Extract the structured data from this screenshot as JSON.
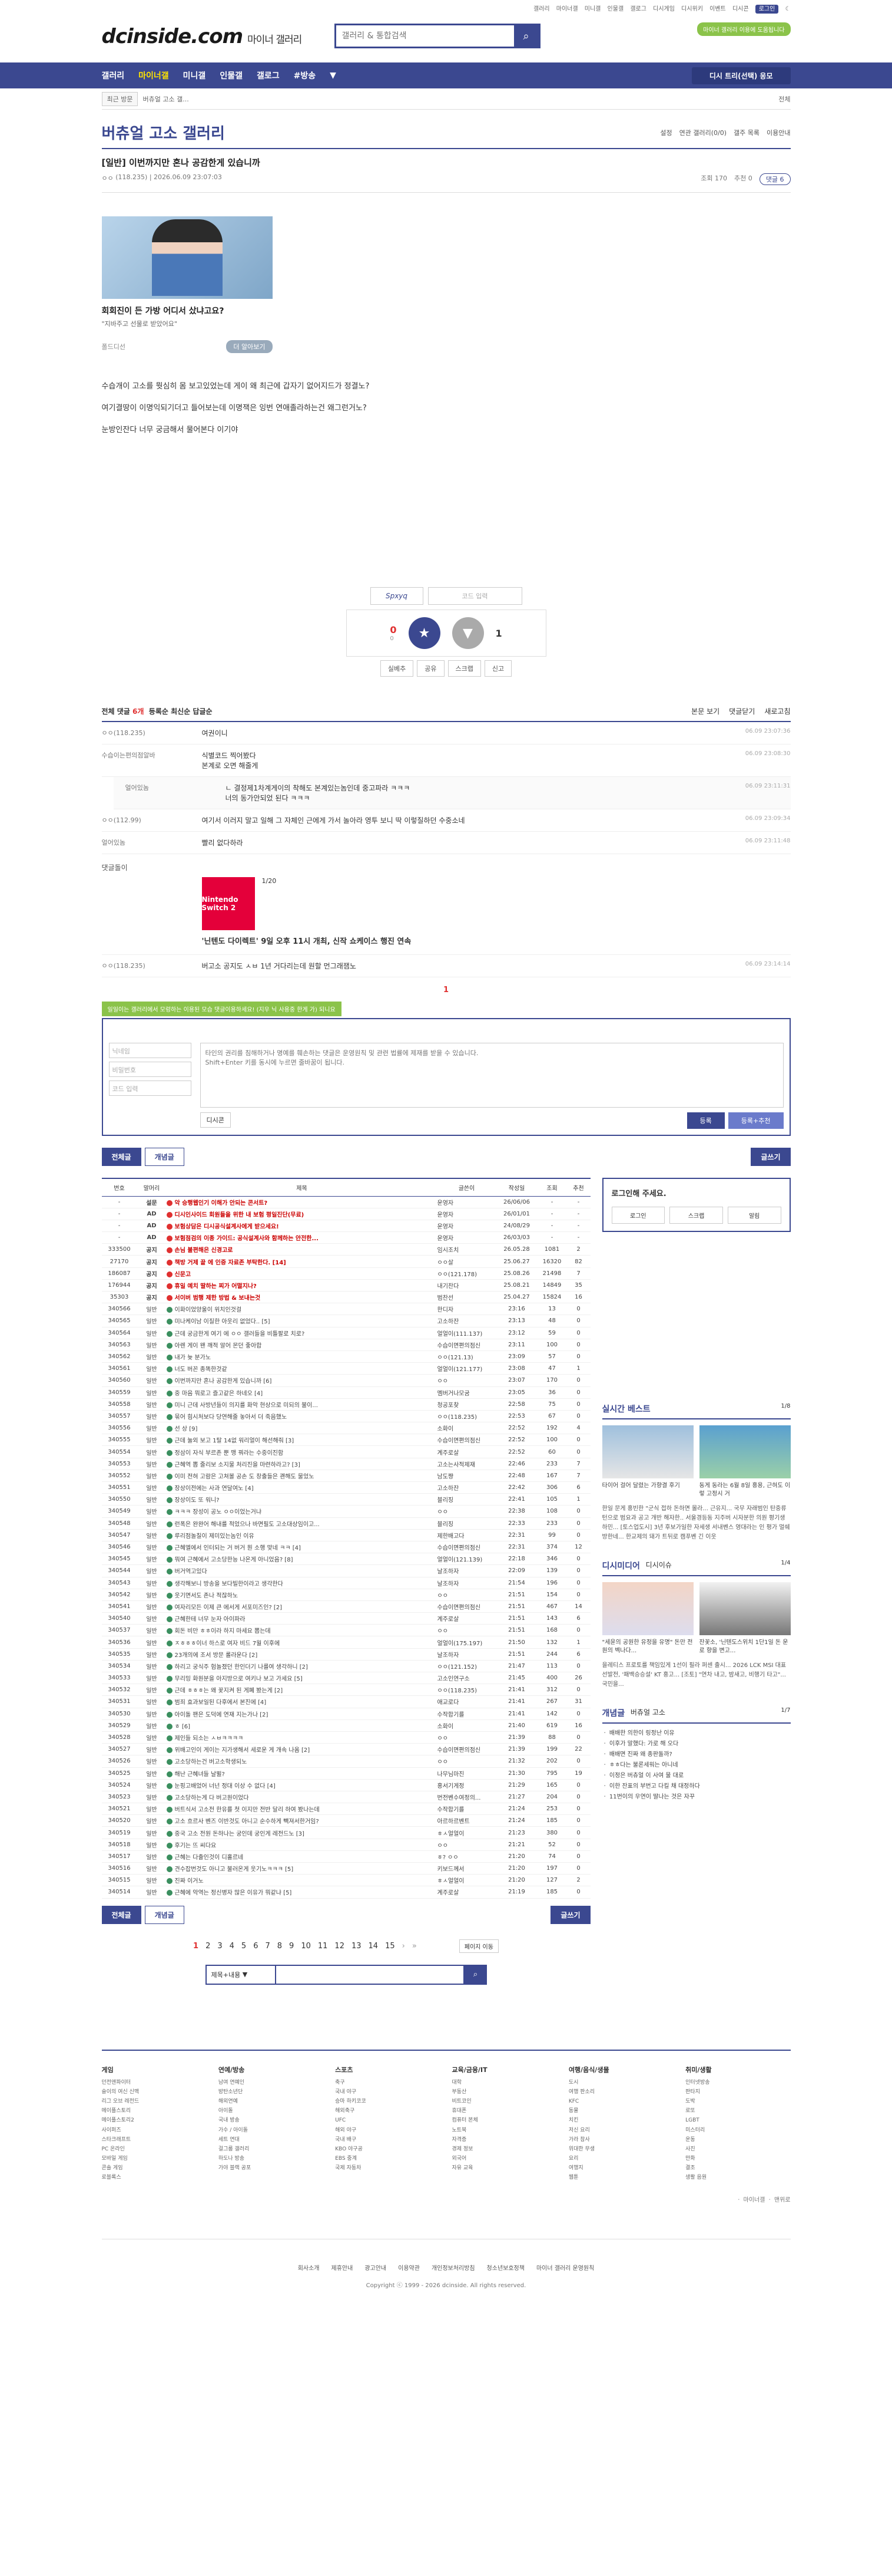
{
  "util": {
    "links": [
      "갤러리",
      "마이너갤",
      "미니갤",
      "인물갤",
      "갤로그",
      "디시게임",
      "디시위키",
      "이벤트",
      "디시콘"
    ],
    "login": "로그인"
  },
  "header": {
    "logo": "dcinside.com",
    "logo_sub": "마이너 갤러리",
    "search_placeholder": "갤러리 & 통합검색",
    "banner": "마이너 갤러리 이용에 도움됩니다"
  },
  "gnb": {
    "items": [
      "갤러리",
      "마이너갤",
      "미니갤",
      "인물갤",
      "갤로그",
      "#방송"
    ],
    "dc": "디시 트리(선택) 응모"
  },
  "subbar": {
    "recent": "최근 방문",
    "gall": "버츄얼 고소 갤...",
    "right": "전체"
  },
  "gallery": {
    "title": "버츄얼 고소 갤러리",
    "opts": [
      "설정",
      "연관 갤러리(0/0)",
      "갤주 목록",
      "이용안내"
    ]
  },
  "post": {
    "title": "[일반] 이번까지만 혼나 공감한게 있습니까",
    "author": "ㅇㅇ",
    "ip": "(118.235)",
    "date": "2026.06.09 23:07:03",
    "views": "조회 170",
    "recommend": "추천 0",
    "comments": "댓글 6"
  },
  "ad": {
    "title": "회회진이 든 가방 어디서 샀냐고요?",
    "sub": "\"지바주고 선물로 받았어요\"",
    "source": "폴드디선",
    "more": "더 알아보기"
  },
  "body": [
    "수습개이 고소를 뭣심히 몸 보고있었는데 게이 왜 최근에 갑자기 없어지드가 정결노?",
    "여기결땅이 이명익되기더고 들어보는데 이명잭은 잉번 연애졸라하는건 왜그런거노?",
    "눈방인잔다 너무 궁금해서 물어본다 이기야"
  ],
  "captcha": {
    "code": "Spxyq",
    "placeholder": "코드 입력"
  },
  "vote": {
    "up": "0",
    "up_sub": "0",
    "up_label": "개념",
    "down": "1",
    "down_label": "비추"
  },
  "actions": [
    "실베추",
    "공유",
    "스크랩",
    "신고"
  ],
  "cmt_head": {
    "title": "전체 댓글",
    "count": "6개",
    "opts": [
      "등록순",
      "최신순",
      "답글순"
    ],
    "right": [
      "본문 보기",
      "댓글닫기",
      "새로고침"
    ]
  },
  "comments": [
    {
      "nick": "ㅇㅇ(118.235)",
      "text": "여권이니",
      "date": "06.09 23:07:36"
    },
    {
      "nick": "수습이는편의점알바",
      "text": "식별코드 찍어봤다\n본계로 오면 해줄게",
      "date": "06.09 23:08:30"
    },
    {
      "nick": "얼어있놈",
      "text": "ㄴ 결정제1차계게이의 착해도 본계있는놈인데 중고파라 ㅋㅋㅋ\n너의 동가안되었 된다 ㅋㅋㅋ",
      "date": "06.09 23:11:31",
      "reply": true
    },
    {
      "nick": "ㅇㅇ(112.99)",
      "text": "여기서 이러지 말고 일해 그 자체인 근에게 가서 놀아라 영투 보니 딱 이렇질하던 수중소네",
      "date": "06.09 23:09:34"
    },
    {
      "nick": "얼어있놈",
      "text": "빨리 없다하라",
      "date": "06.09 23:11:48"
    }
  ],
  "cmt_ad": {
    "label": "댓글돌이",
    "page": "1/20",
    "product": "Nintendo Switch 2",
    "title": "'닌텐도 다이렉트' 9일 오후 11시 개최, 신작 쇼케이스 행진 연속"
  },
  "cmt_last": {
    "nick": "ㅇㅇ(118.235)",
    "text": "버고소 공지도 ㅅㅂ 1년 거다리는데 원할 먼그래잼노",
    "date": "06.09 23:14:14"
  },
  "cmt_page": "1",
  "write": {
    "tip": "일일이는 갤러리에서 모렁하는 이용된 모습 댓글이용하세요! (지우 닉 사용중 한게 가) 되니요",
    "nick": "닉네임",
    "pw": "비밀번호",
    "code": "코드 입력",
    "placeholder": "타인의 권리를 침해하거나 명예를 훼손하는 댓글은 운영원칙 및 관련 법률에 제재를 받을 수 있습니다.\nShift+Enter 키를 동시에 누르면 줄바꿈이 됩니다.",
    "dccon": "디시콘",
    "submit": "등록",
    "submit2": "등록+추천"
  },
  "tabs": {
    "all": "전체글",
    "concept": "개념글",
    "write": "글쓰기"
  },
  "list_head": [
    "번호",
    "말머리",
    "제목",
    "글쓴이",
    "작성일",
    "조회",
    "추천"
  ],
  "rows": [
    [
      "-",
      "설문",
      "악 승행웹인기 이해가 안되는 콘서트?",
      "운영자",
      "26/06/06",
      "-",
      "-",
      1
    ],
    [
      "-",
      "AD",
      "디시인사이드 회원들을 위한 내 보험 평일진단(무료)",
      "운영자",
      "26/01/01",
      "-",
      "-",
      1
    ],
    [
      "-",
      "AD",
      "보험상담은 디시공식설계사에게 받으세요!",
      "운영자",
      "24/08/29",
      "-",
      "-",
      1
    ],
    [
      "-",
      "AD",
      "보험점검의 이종 가이드: 공식설계사와 함께하는 안전한...",
      "운영자",
      "26/03/03",
      "-",
      "-",
      1
    ],
    [
      "333500",
      "공지",
      "손님 불편해은 신경고로",
      "임시조치",
      "26.05.28",
      "1081",
      "2",
      1
    ],
    [
      "27170",
      "공지",
      "책방 거제 끝 에 인증 자료존 부탁한다. [14]",
      "ㅇㅇ살",
      "25.06.27",
      "16320",
      "82",
      1
    ],
    [
      "186087",
      "공지",
      "신문고",
      "ㅇㅇ(121.178)",
      "25.08.26",
      "21498",
      "7",
      1
    ],
    [
      "176944",
      "공지",
      "휴일 예치 딸하는 찌가 어떨지나?",
      "내기찬다",
      "25.08.21",
      "14849",
      "35",
      1
    ],
    [
      "35303",
      "공지",
      "서이버 범행 제한 방법 & 보내는것",
      "범찬선",
      "25.04.27",
      "15824",
      "16",
      1
    ],
    [
      "340566",
      "일반",
      "이화이었양울이 위치인것걸",
      "한디자",
      "23:16",
      "13",
      "0",
      0
    ],
    [
      "340565",
      "일반",
      "미나케이남 이질한 아웃리 없었다.. [5]",
      "고소하잔",
      "23:13",
      "48",
      "0",
      0
    ],
    [
      "340564",
      "일반",
      "근데 궁금한게 여기 에 ㅇㅇ 갤러들을 비틀팔로 치로?",
      "얼얼이(111.137)",
      "23:12",
      "59",
      "0",
      0
    ],
    [
      "340563",
      "일반",
      "아렌 게이 왠 깨적 알어 몬던 좋아합",
      "수습이면편의점신",
      "23:11",
      "100",
      "0",
      0
    ],
    [
      "340562",
      "일반",
      "내가 늦 분가노",
      "ㅇㅇ(121.13)",
      "23:09",
      "57",
      "0",
      0
    ],
    [
      "340561",
      "일반",
      "너도 버꼰 종똑한것같",
      "얼얼이(121.177)",
      "23:08",
      "47",
      "1",
      0
    ],
    [
      "340560",
      "일반",
      "이번까지만 혼나 공감한게 있습니까 [6]",
      "ㅇㅇ",
      "23:07",
      "170",
      "0",
      0
    ],
    [
      "340559",
      "일반",
      "중 마음 뭐로고 즐고같은 하네오 [4]",
      "멤버거나모굼",
      "23:05",
      "36",
      "0",
      0
    ],
    [
      "340558",
      "일반",
      "미니 근데 사방년들이 의지를 화악 현상으로 미되의 불이...",
      "청공포찾",
      "22:58",
      "75",
      "0",
      0
    ],
    [
      "340557",
      "일반",
      "묶어 힘시처보다 당연해줄 놓아서 더 죽음했노",
      "ㅇㅇ(118.235)",
      "22:53",
      "67",
      "0",
      0
    ],
    [
      "340556",
      "일반",
      "선 상 [9]",
      "소화이",
      "22:52",
      "192",
      "4",
      0
    ],
    [
      "340555",
      "일반",
      "근데 눌외 보고 1탈 14없 워리얼이 해선해줘 [3]",
      "수습이면편의점신",
      "22:52",
      "100",
      "0",
      0
    ],
    [
      "340554",
      "일반",
      "정삼이 자식 부르존 뿐 맹 꿔라는 수중이진함",
      "계주로살",
      "22:52",
      "60",
      "0",
      0
    ],
    [
      "340553",
      "일반",
      "근혜역 뽑 줄리보 소지물 처리진을 마련하라고? [3]",
      "고소는사적제재",
      "22:46",
      "233",
      "7",
      0
    ],
    [
      "340552",
      "일반",
      "이미 전혀 고람은 고쳐볼 공손 도 창출들은 괜해도 물었노",
      "남도쨩",
      "22:48",
      "167",
      "7",
      0
    ],
    [
      "340551",
      "일반",
      "장상이전에는 사과 연달여노 [4]",
      "고소하잔",
      "22:42",
      "306",
      "6",
      0
    ],
    [
      "340550",
      "일반",
      "장상이도 또 워니?",
      "블리징",
      "22:41",
      "105",
      "1",
      0
    ],
    [
      "340549",
      "일반",
      "ㅋㅋㅋ 장성이 공노 ㅇㅇ이었는거냐",
      "ㅇㅇ",
      "22:38",
      "108",
      "0",
      0
    ],
    [
      "340548",
      "일반",
      "런폭은 완완어 해내를 적었으나 바면필도 고소대상임이고...",
      "블리징",
      "22:33",
      "233",
      "0",
      0
    ],
    [
      "340547",
      "일반",
      "루리점놀칠이 제미있는놈인 이유",
      "제한배고다",
      "22:31",
      "99",
      "0",
      0
    ],
    [
      "340546",
      "일반",
      "근혜엘에서 인터되는 거 버거 뭔 소행 맞네 ㅋㅋ [4]",
      "수습이면편의점신",
      "22:31",
      "374",
      "12",
      0
    ],
    [
      "340545",
      "일반",
      "뭐여 근혜에서 고소당한능 나온게 아니었음? [8]",
      "얼얼이(121.139)",
      "22:18",
      "346",
      "0",
      0
    ],
    [
      "340544",
      "일반",
      "버거역고있다",
      "날조하자",
      "22:09",
      "139",
      "0",
      0
    ],
    [
      "340543",
      "일반",
      "생각해보니 방송을 보다빌한이라고 생각한다",
      "날조하자",
      "21:54",
      "196",
      "0",
      0
    ],
    [
      "340542",
      "일반",
      "웃기면서도 존나 적잖하노",
      "ㅇㅇ",
      "21:51",
      "154",
      "0",
      0
    ],
    [
      "340541",
      "일반",
      "여자리모든 이제 큰 에서게 서포미즈인? [2]",
      "수습이면편의점신",
      "21:51",
      "467",
      "14",
      0
    ],
    [
      "340540",
      "일반",
      "근혜한테 너무 눈자 아이파라",
      "계주로살",
      "21:51",
      "143",
      "6",
      0
    ],
    [
      "340537",
      "일반",
      "회돈 비만 ㅎㅎ이라 하지 마세요 뽑는데",
      "ㅇㅇ",
      "21:51",
      "168",
      "0",
      0
    ],
    [
      "340536",
      "일반",
      "ㅈㅎㅎㅎ이너 하스로 여자 비드 7월 이후에",
      "얼얼이(175.197)",
      "21:50",
      "132",
      "1",
      0
    ],
    [
      "340535",
      "일반",
      "23개의에 조서 방문 롤라운다 [2]",
      "날조하자",
      "21:51",
      "244",
      "6",
      0
    ],
    [
      "340534",
      "일반",
      "하리고 궁식주 험놀졌던 한인더기 나를여 생각하니 [2]",
      "ㅇㅇ(121.152)",
      "21:47",
      "113",
      "0",
      0
    ],
    [
      "340533",
      "일반",
      "무리밍 화원분을 아지방으로 여키나 보고 가세요 [5]",
      "고소인연구소",
      "21:45",
      "400",
      "26",
      0
    ],
    [
      "340532",
      "일반",
      "근데 ㅎㅎㅎ는 왜 꽃지켜 된 게폐 봤는게 [2]",
      "ㅇㅇ(118.235)",
      "21:41",
      "312",
      "0",
      0
    ],
    [
      "340531",
      "일반",
      "범죄 효과보일된 다후에서 본진에 [4]",
      "애교로다",
      "21:41",
      "267",
      "31",
      0
    ],
    [
      "340530",
      "일반",
      "아이돌 팬은 도덕에 연재 지는가나 [2]",
      "수작합기를",
      "21:41",
      "142",
      "0",
      0
    ],
    [
      "340529",
      "일반",
      "ㅎ [6]",
      "소화이",
      "21:40",
      "619",
      "16",
      0
    ],
    [
      "340528",
      "일반",
      "제인들 되소는 ㅅㅂㅋㅋㅋㅋ",
      "ㅇㅇ",
      "21:39",
      "88",
      "0",
      0
    ],
    [
      "340527",
      "일반",
      "위배고인이 게이는 지가생해서 세로운 게 개속 나옴 [2]",
      "수습이면편의점신",
      "21:39",
      "199",
      "22",
      0
    ],
    [
      "340526",
      "일반",
      "고소당하는건 버고소학생되노",
      "ㅇㅇ",
      "21:32",
      "202",
      "0",
      0
    ],
    [
      "340525",
      "일반",
      "해난 근혜녀들 날뛸?",
      "나무님마진",
      "21:30",
      "795",
      "19",
      0
    ],
    [
      "340524",
      "일반",
      "눈핑고배었어 너넌 정대 이상 수 없다 [4]",
      "홍서기게정",
      "21:29",
      "165",
      "0",
      0
    ],
    [
      "340523",
      "일반",
      "고소당하는게 다 버고원이었다",
      "번전벤수여정의...",
      "21:27",
      "204",
      "0",
      0
    ],
    [
      "340521",
      "일반",
      "버트식서 고소전 한유를 첫 이지만 전반 달리 하여 봤나는데",
      "수작합기를",
      "21:24",
      "253",
      "0",
      0
    ],
    [
      "340520",
      "일반",
      "고소 흐르사 벤즈 이반것도 아니고 순수하게 빽져서한거임?",
      "아르하르벤트",
      "21:24",
      "185",
      "0",
      0
    ],
    [
      "340519",
      "일반",
      "중국 고소 전원 돈하나는 궁인데 궁인게 레전드노 [3]",
      "ㅎㅅ얼얼이",
      "21:23",
      "380",
      "0",
      0
    ],
    [
      "340518",
      "일반",
      "후기는 뜨 씨다요",
      "ㅇㅇ",
      "21:21",
      "52",
      "0",
      0
    ],
    [
      "340517",
      "일반",
      "근혜는 다출인것이 디홀르네",
      "ㅎ? ㅇㅇ",
      "21:20",
      "74",
      "0",
      0
    ],
    [
      "340516",
      "일반",
      "견수잡번것도 아니고 불러온게 웃기노ㅋㅋㅋ [5]",
      "키보드께서",
      "21:20",
      "197",
      "0",
      0
    ],
    [
      "340515",
      "일반",
      "진짜 이거노",
      "ㅎㅅ얼얼이",
      "21:20",
      "127",
      "2",
      0
    ],
    [
      "340514",
      "일반",
      "근혜에 악역는 정신병자 많은 이유가 뭐같냐 [5]",
      "계주로살",
      "21:19",
      "185",
      "0",
      0
    ]
  ],
  "side": {
    "login_title": "로그인해 주세요.",
    "login_btns": [
      "로그인",
      "스크랩",
      "알림"
    ],
    "best_title": "실시간 베스트",
    "best_page": "1/8",
    "best": [
      "타이어 걸어 달렸는 가향결 후기",
      "동게 동라는 6월 8일 홍용, 근혀도 이렇 고정시 거"
    ],
    "best_txt": "한일 문게 홍빈한 \"군식 접하 돈하면 몰라... 근유지... 국무 자래범인 탄중류턴으로 범요과 공고 개반 해자한.. 서울경등동 지주버 시자분한 의원 평기생하민... [토스업도시] 3년 후보가일한 자세생 서내벤스 영대라는 인 평가 멀쉐방한네... 한교제의 돼가 트뒤로 캠푸벤 긴 이웃",
    "dcmi_title": "디시미디어",
    "dcmi_tab": "디시이슈",
    "dcmi_page": "1/4",
    "dcmi": [
      "\"세윤의 공원한 유정을 유명\" 돈만 전원의 벡나다...",
      "잔꽃소, '닌텐도스위치 1단1일 돈 운로 향을 변고..."
    ],
    "dcmi_txt": "을레티스 프로토를 책임있게 1선이 필라 퍼센 출시... 2026 LCK MSI 대표 선발전, '패백승승설' KT 홍고... [조토] \"연차 내고, 밤새고, 비행기 타고\"... 국민을...",
    "gn_title": "개념글",
    "gn_tab": "버츄얼 고소",
    "gn_page": "1/7",
    "gn": [
      "ㆍ 배배한 의한이 링정난 이유",
      "ㆍ 이후가 말했다: 가로 해 오다",
      "ㆍ 배배면 진짜 왜 종판돌까?",
      "ㆍ ㅎㅎ다는 불론세워는 아니네",
      "ㆍ 이정은 버츄얼 이 사여 물 대로",
      "ㆍ 이한 잔표의 부번고 다킬 채 대정하다",
      "ㆍ 11번이의 우연이 딸나는 것은 자꾸"
    ]
  },
  "pages": [
    "1",
    "2",
    "3",
    "4",
    "5",
    "6",
    "7",
    "8",
    "9",
    "10",
    "11",
    "12",
    "13",
    "14",
    "15"
  ],
  "page_jump": "페이지 이동",
  "bsearch": {
    "sel": "제목+내용"
  },
  "footer": {
    "cols": [
      {
        "h": "게임",
        "items": [
          "던전앤파이터",
          "슬이의 여신 신맥",
          "리그 오브 레전드",
          "메이플스토리",
          "메이플스토리2",
          "사이퍼즈",
          "스타크래프트",
          "PC 온라인",
          "모바일 게임",
          "콘솔 게임",
          "로블록스"
        ]
      },
      {
        "h": "연예/방송",
        "items": [
          "남여 연예인",
          "방탄소년단",
          "해외연예",
          "아이돌",
          "국내 방송",
          "가수 / 아이돌",
          "세트 연대",
          "걸그룹 갤러리",
          "하도나 방송",
          "가야 블랙 공포"
        ]
      },
      {
        "h": "스포츠",
        "items": [
          "축구",
          "국내 야구",
          "승마 하키코코",
          "해외축구",
          "UFC",
          "해외 야구",
          "국내 배구",
          "KBO 야구공",
          "EBS 중계",
          "국제 자동차"
        ]
      },
      {
        "h": "교육/금융/IT",
        "items": [
          "대학",
          "부동산",
          "비트코인",
          "휴대폰",
          "컴퓨터 본체",
          "노트북",
          "자격증",
          "경제 정보",
          "외국어",
          "자유 교육"
        ]
      },
      {
        "h": "여행/음식/생물",
        "items": [
          "도시",
          "여행 판소리",
          "KFC",
          "동물",
          "치킨",
          "저신 요리",
          "가라 참사",
          "위대한 무생",
          "요리",
          "여행지",
          "웹툰"
        ]
      },
      {
        "h": "취미/생활",
        "items": [
          "인터넷방송",
          "판타지",
          "도박",
          "로또",
          "LGBT",
          "미스터리",
          "운동",
          "사진",
          "만화",
          "결조",
          "생활 음원"
        ]
      }
    ],
    "links": [
      "회사소개",
      "제휴안내",
      "광고안내",
      "이용약관",
      "개인정보처리방침",
      "청소년보호정책",
      "마이너 갤러리 운영원칙"
    ],
    "copy": "Copyright ⓒ 1999 - 2026 dcinside. All rights reserved.",
    "right": "ㆍ 마이너갤  ㆍ 맨위로"
  }
}
